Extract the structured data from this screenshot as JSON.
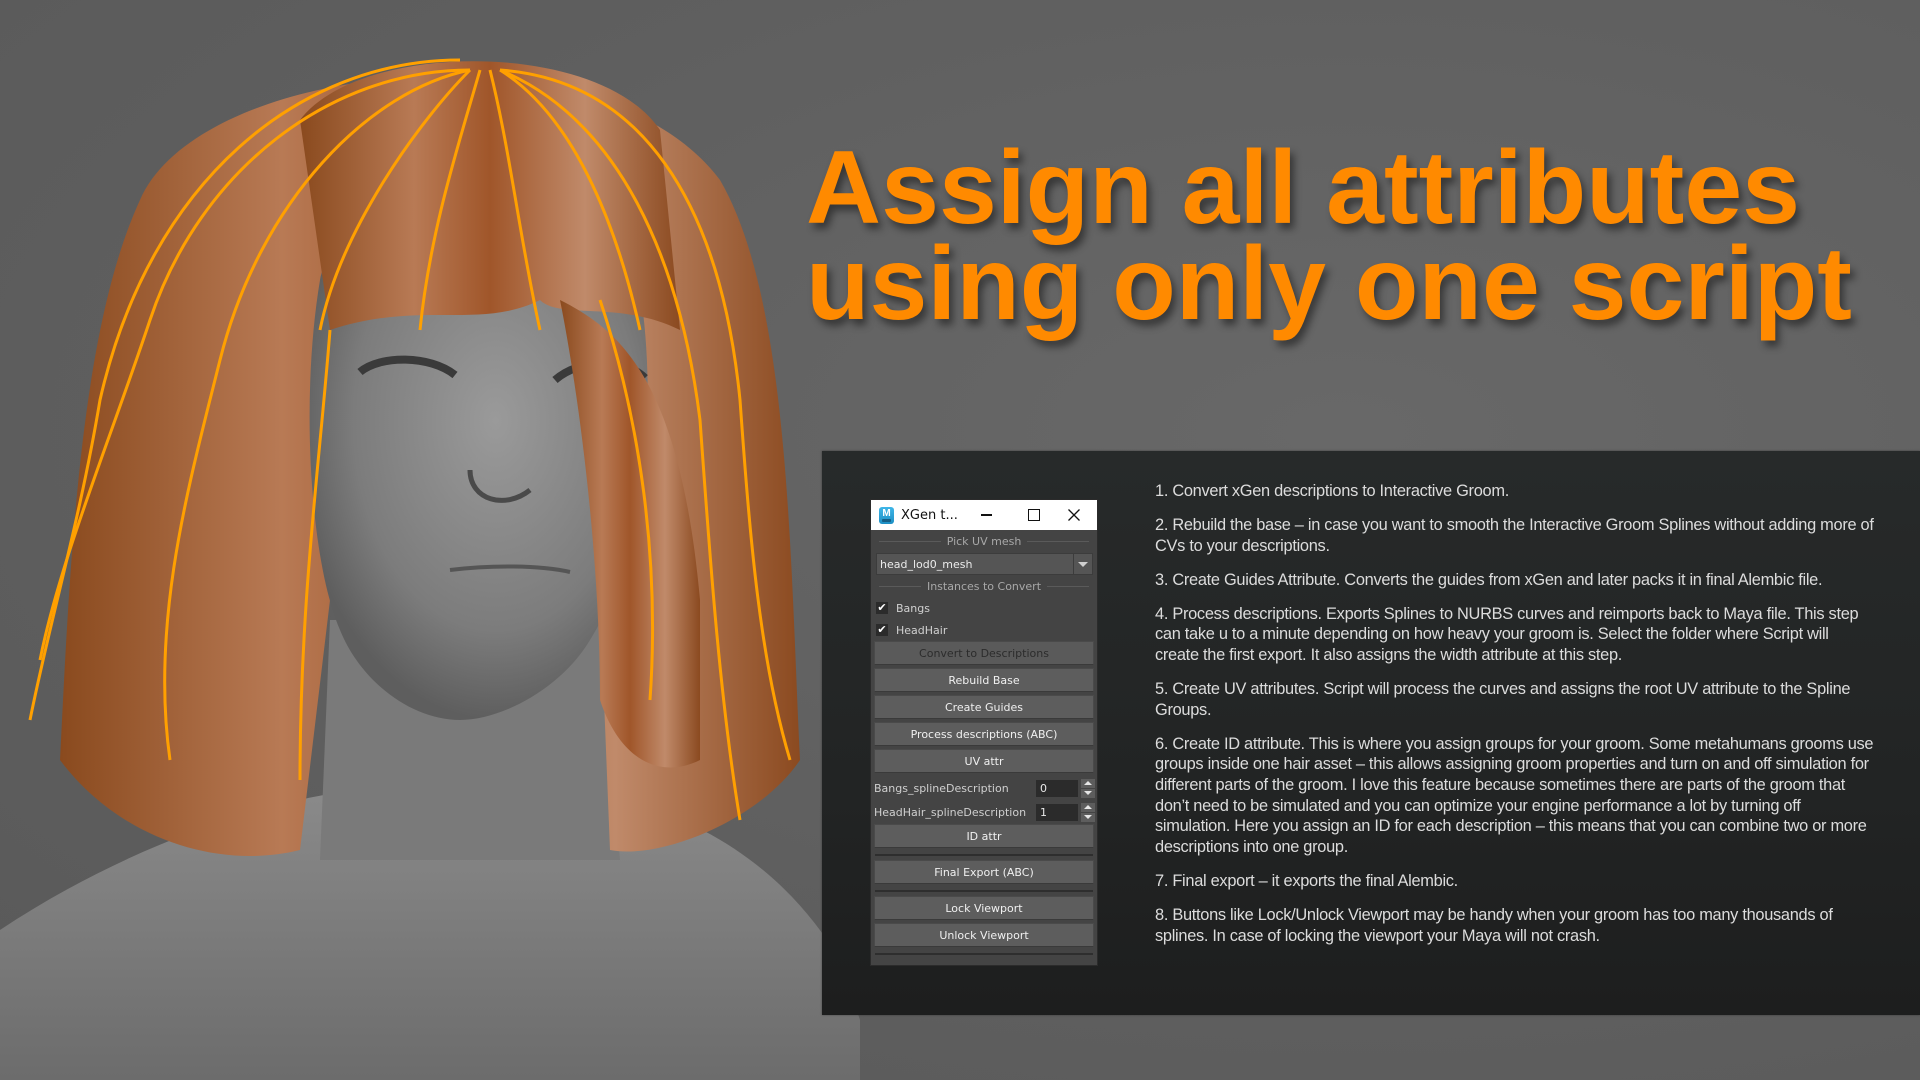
{
  "headline": {
    "line1": "Assign all attributes",
    "line2": "using only one script",
    "color": "#ff8a00"
  },
  "render": {
    "description": "3D viewport render of a female head with orange-highlighted hair guide curves",
    "guide_color": "#ffa000"
  },
  "xgen_window": {
    "app_icon": "maya-icon",
    "app_icon_letter": "M",
    "title": "XGen t...",
    "controls": {
      "minimize": "minimize-icon",
      "maximize": "maximize-icon",
      "close": "close-icon"
    },
    "pick_uv_mesh_label": "Pick UV mesh",
    "uv_mesh_value": "head_lod0_mesh",
    "instances_label": "Instances to Convert",
    "instances": [
      {
        "label": "Bangs",
        "checked": true,
        "check_glyph": "✔"
      },
      {
        "label": "HeadHair",
        "checked": true,
        "check_glyph": "✔"
      }
    ],
    "buttons": {
      "convert": "Convert to Descriptions",
      "rebuild": "Rebuild Base",
      "guides": "Create Guides",
      "process": "Process descriptions (ABC)",
      "uv_attr": "UV attr",
      "id_attr": "ID attr",
      "final_export": "Final Export (ABC)",
      "lock": "Lock Viewport",
      "unlock": "Unlock Viewport"
    },
    "id_fields": [
      {
        "label": "Bangs_splineDescription",
        "value": "0"
      },
      {
        "label": "HeadHair_splineDescription",
        "value": "1"
      }
    ]
  },
  "steps": [
    "1. Convert xGen descriptions to Interactive Groom.",
    "2. Rebuild the base – in case you want to smooth the Interactive Groom Splines without adding more of CVs to your descriptions.",
    "3. Create Guides Attribute. Converts the guides from xGen and later packs it in final Alembic file.",
    "4. Process descriptions. Exports Splines to NURBS curves and reimports back to Maya file. This step can take u to a minute depending on how heavy your groom is. Select the folder where Script will create the first export.  It also assigns the width attribute at this step.",
    "5. Create UV attributes.  Script will process the curves and assigns the root UV attribute to the Spline Groups.",
    "6. Create ID attribute. This is where you assign groups for your groom. Some metahumans grooms use groups inside one hair asset – this allows assigning groom properties and turn on and off simulation for different parts of the groom. I love this feature because sometimes there are parts of the groom that don’t need to be simulated and you can optimize your engine performance a lot by turning off simulation. Here you assign an ID for each description – this means that you can combine two or more descriptions into one group.",
    "7. Final export – it exports the final Alembic.",
    "8. Buttons like Lock/Unlock Viewport may be handy when your groom has too many thousands of splines. In case of locking the viewport your Maya will not crash."
  ]
}
